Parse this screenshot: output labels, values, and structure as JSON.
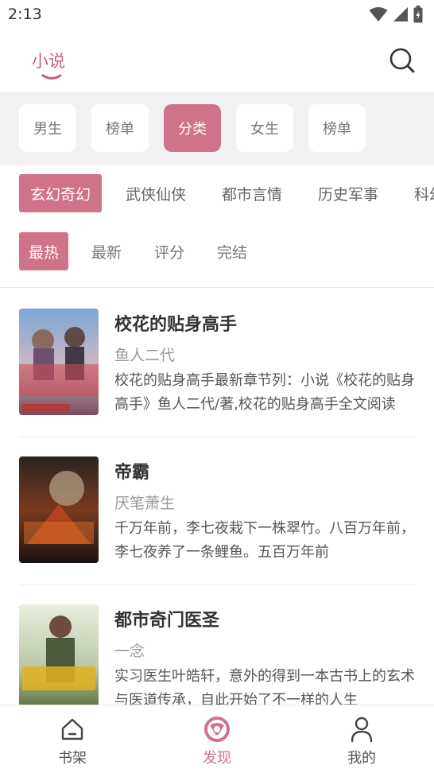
{
  "status_bar": {
    "time": "2:13"
  },
  "header": {
    "title": "小说"
  },
  "filters": [
    {
      "label": "男生",
      "active": false
    },
    {
      "label": "榜单",
      "active": false
    },
    {
      "label": "分类",
      "active": true
    },
    {
      "label": "女生",
      "active": false
    },
    {
      "label": "榜单",
      "active": false
    }
  ],
  "genres": [
    {
      "label": "玄幻奇幻",
      "active": true
    },
    {
      "label": "武侠仙侠",
      "active": false
    },
    {
      "label": "都市言情",
      "active": false
    },
    {
      "label": "历史军事",
      "active": false
    },
    {
      "label": "科幻",
      "active": false
    }
  ],
  "sorts": [
    {
      "label": "最热",
      "active": true
    },
    {
      "label": "最新",
      "active": false
    },
    {
      "label": "评分",
      "active": false
    },
    {
      "label": "完结",
      "active": false
    }
  ],
  "books": [
    {
      "title": "校花的贴身高手",
      "author": "鱼人二代",
      "desc": "校花的贴身高手最新章节列：小说《校花的贴身高手》鱼人二代/著,校花的贴身高手全文阅读"
    },
    {
      "title": "帝霸",
      "author": "厌笔萧生",
      "desc": "千万年前，李七夜栽下一株翠竹。八百万年前，李七夜养了一条鲤鱼。五百万年前"
    },
    {
      "title": "都市奇门医圣",
      "author": "一念",
      "desc": "实习医生叶皓轩，意外的得到一本古书上的玄术与医道传承，自此开始了不一样的人生"
    }
  ],
  "tabs": [
    {
      "label": "书架",
      "icon": "home-icon",
      "active": false
    },
    {
      "label": "发现",
      "icon": "discover-icon",
      "active": true
    },
    {
      "label": "我的",
      "icon": "user-icon",
      "active": false
    }
  ],
  "colors": {
    "accent": "#d1728b",
    "title_pink": "#c95f7a",
    "band_bg": "#f2f2f4"
  }
}
